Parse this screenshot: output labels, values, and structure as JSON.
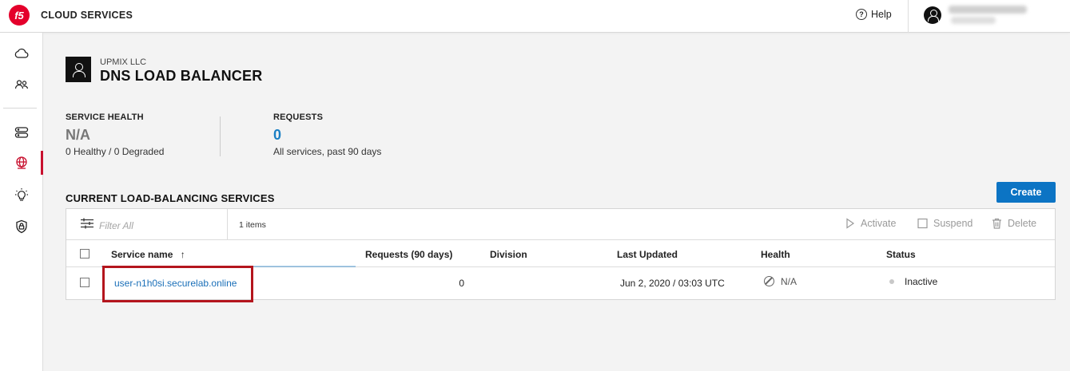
{
  "app": {
    "logo_text": "f5",
    "title": "CLOUD SERVICES"
  },
  "header": {
    "help_label": "Help"
  },
  "sidebar": {
    "items": [
      {
        "icon": "cloud-icon"
      },
      {
        "icon": "users-icon"
      },
      {
        "icon": "server-icon"
      },
      {
        "icon": "globe-icon",
        "active": true
      },
      {
        "icon": "lightbulb-icon"
      },
      {
        "icon": "shield-lock-icon"
      }
    ]
  },
  "page": {
    "org": "UPMIX LLC",
    "title": "DNS LOAD BALANCER"
  },
  "stats": {
    "health_label": "SERVICE HEALTH",
    "health_value": "N/A",
    "health_sub": "0 Healthy / 0 Degraded",
    "requests_label": "REQUESTS",
    "requests_value": "0",
    "requests_sub": "All services, past 90 days"
  },
  "services": {
    "section_title": "CURRENT LOAD-BALANCING SERVICES",
    "create_label": "Create",
    "filter_placeholder": "Filter All",
    "items_count": "1 items",
    "actions": {
      "activate": "Activate",
      "suspend": "Suspend",
      "delete": "Delete"
    },
    "columns": {
      "service_name": "Service name",
      "sort_indicator": "↑",
      "requests": "Requests (90 days)",
      "division": "Division",
      "last_updated": "Last Updated",
      "health": "Health",
      "status": "Status"
    },
    "rows": [
      {
        "service_name": "user-n1h0si.securelab.online",
        "requests": "0",
        "division": "",
        "last_updated": "Jun 2, 2020 / 03:03 UTC",
        "health": "N/A",
        "status": "Inactive"
      }
    ]
  },
  "colors": {
    "brand": "#e4002b",
    "accent": "#0c74c4",
    "requests_value": "#1a7fc4",
    "health_value": "#777777",
    "highlight": "#b4151d"
  }
}
